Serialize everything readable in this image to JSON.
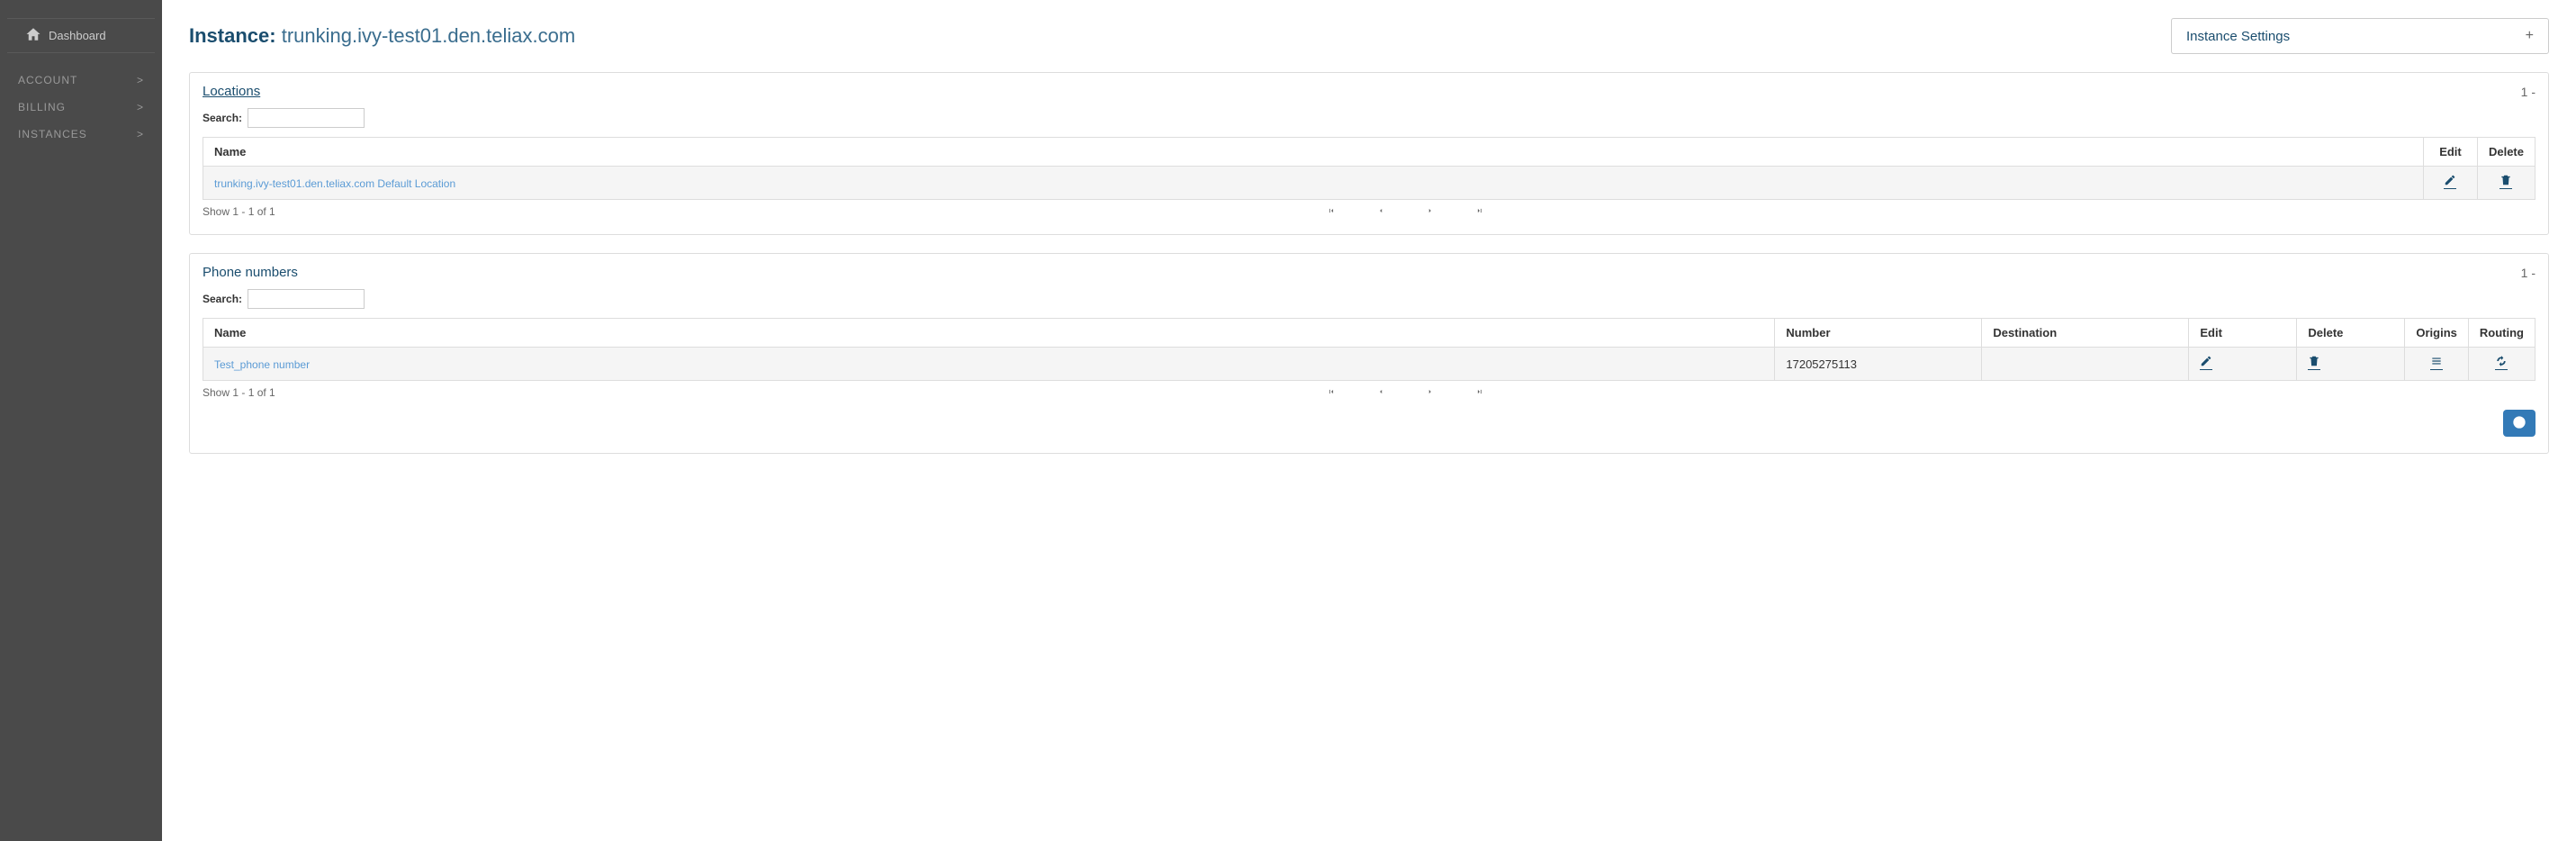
{
  "sidebar": {
    "dashboard": "Dashboard",
    "items": [
      {
        "label": "ACCOUNT"
      },
      {
        "label": "BILLING"
      },
      {
        "label": "INSTANCES"
      }
    ],
    "chevron": ">"
  },
  "header": {
    "title_prefix": "Instance: ",
    "title_value": "trunking.ivy-test01.den.teliax.com",
    "settings_label": "Instance Settings",
    "settings_plus": "+"
  },
  "locations_panel": {
    "title": "Locations",
    "header_right": "1   -",
    "search_label": "Search:",
    "columns": {
      "name": "Name",
      "edit": "Edit",
      "delete": "Delete"
    },
    "rows": [
      {
        "name": "trunking.ivy-test01.den.teliax.com Default Location"
      }
    ],
    "show": "Show 1 - 1 of 1"
  },
  "phones_panel": {
    "title": "Phone numbers",
    "header_right": "1   -",
    "search_label": "Search:",
    "columns": {
      "name": "Name",
      "number": "Number",
      "destination": "Destination",
      "edit": "Edit",
      "delete": "Delete",
      "origins": "Origins",
      "routing": "Routing"
    },
    "rows": [
      {
        "name": "Test_phone number",
        "number": "17205275113",
        "destination": ""
      }
    ],
    "show": "Show 1 - 1 of 1"
  }
}
